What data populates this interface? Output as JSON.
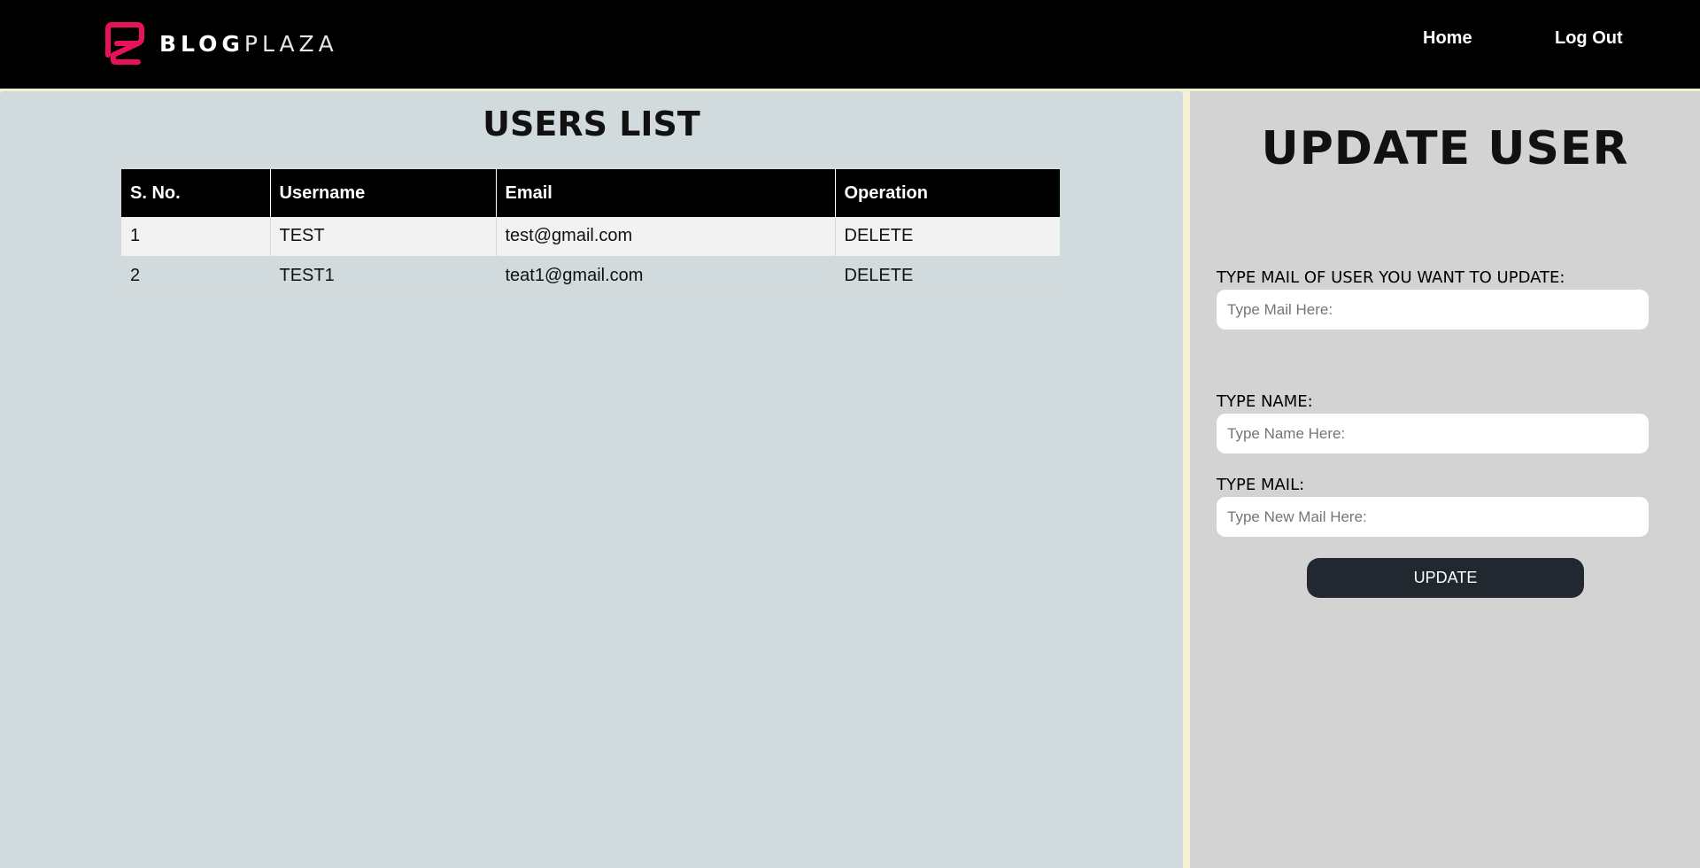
{
  "brand": {
    "name_bold": "BLOG",
    "name_light": "PLAZA",
    "logo_color": "#e8125c",
    "icon": "blogplaza-logo-icon"
  },
  "nav": {
    "home": "Home",
    "logout": "Log Out"
  },
  "users_list": {
    "title": "USERS LIST",
    "columns": [
      "S. No.",
      "Username",
      "Email",
      "Operation"
    ],
    "rows": [
      {
        "sno": "1",
        "username": "TEST",
        "email": "test@gmail.com",
        "operation": "DELETE"
      },
      {
        "sno": "2",
        "username": "TEST1",
        "email": "teat1@gmail.com",
        "operation": "DELETE"
      }
    ]
  },
  "update_user": {
    "title": "UPDATE USER",
    "mail_label": "TYPE MAIL OF USER YOU WANT TO UPDATE:",
    "mail_placeholder": "Type Mail Here:",
    "name_label": "TYPE NAME:",
    "name_placeholder": "Type Name Here:",
    "new_mail_label": "TYPE MAIL:",
    "new_mail_placeholder": "Type New Mail Here:",
    "button": "UPDATE"
  },
  "colors": {
    "navbar_bg": "#000000",
    "left_panel_bg": "#d1dbdd",
    "right_panel_bg": "#d3d3d3",
    "divider": "#f4f1d2",
    "button_bg": "#212830"
  }
}
